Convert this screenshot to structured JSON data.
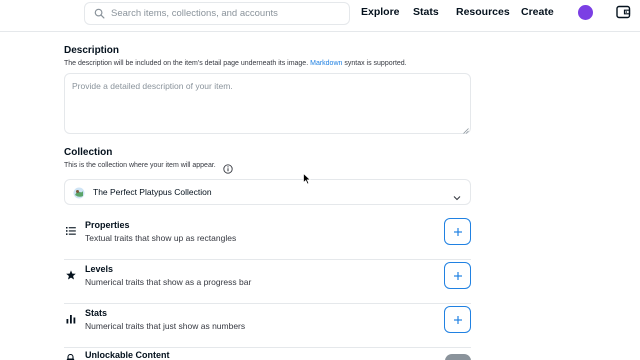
{
  "header": {
    "search_placeholder": "Search items, collections, and accounts",
    "nav": [
      "Explore",
      "Stats",
      "Resources",
      "Create"
    ],
    "avatar_color": "#7b3fe4"
  },
  "description": {
    "title": "Description",
    "subtitle_before": "The description will be included on the item's detail page underneath its image.",
    "link": "Markdown",
    "subtitle_after": "syntax is supported.",
    "placeholder": "Provide a detailed description of your item."
  },
  "collection": {
    "title": "Collection",
    "subtitle": "This is the collection where your item will appear.",
    "selected": "The Perfect Platypus Collection"
  },
  "traits": [
    {
      "icon": "list-icon",
      "name": "Properties",
      "desc": "Textual traits that show up as rectangles"
    },
    {
      "icon": "star-icon",
      "name": "Levels",
      "desc": "Numerical traits that show as a progress bar"
    },
    {
      "icon": "bar-chart-icon",
      "name": "Stats",
      "desc": "Numerical traits that just show as numbers"
    }
  ],
  "unlockable": {
    "name": "Unlockable Content"
  },
  "colors": {
    "accent": "#2081e2",
    "text": "#04111d",
    "muted": "#8a939b",
    "border": "#e5e8eb"
  }
}
